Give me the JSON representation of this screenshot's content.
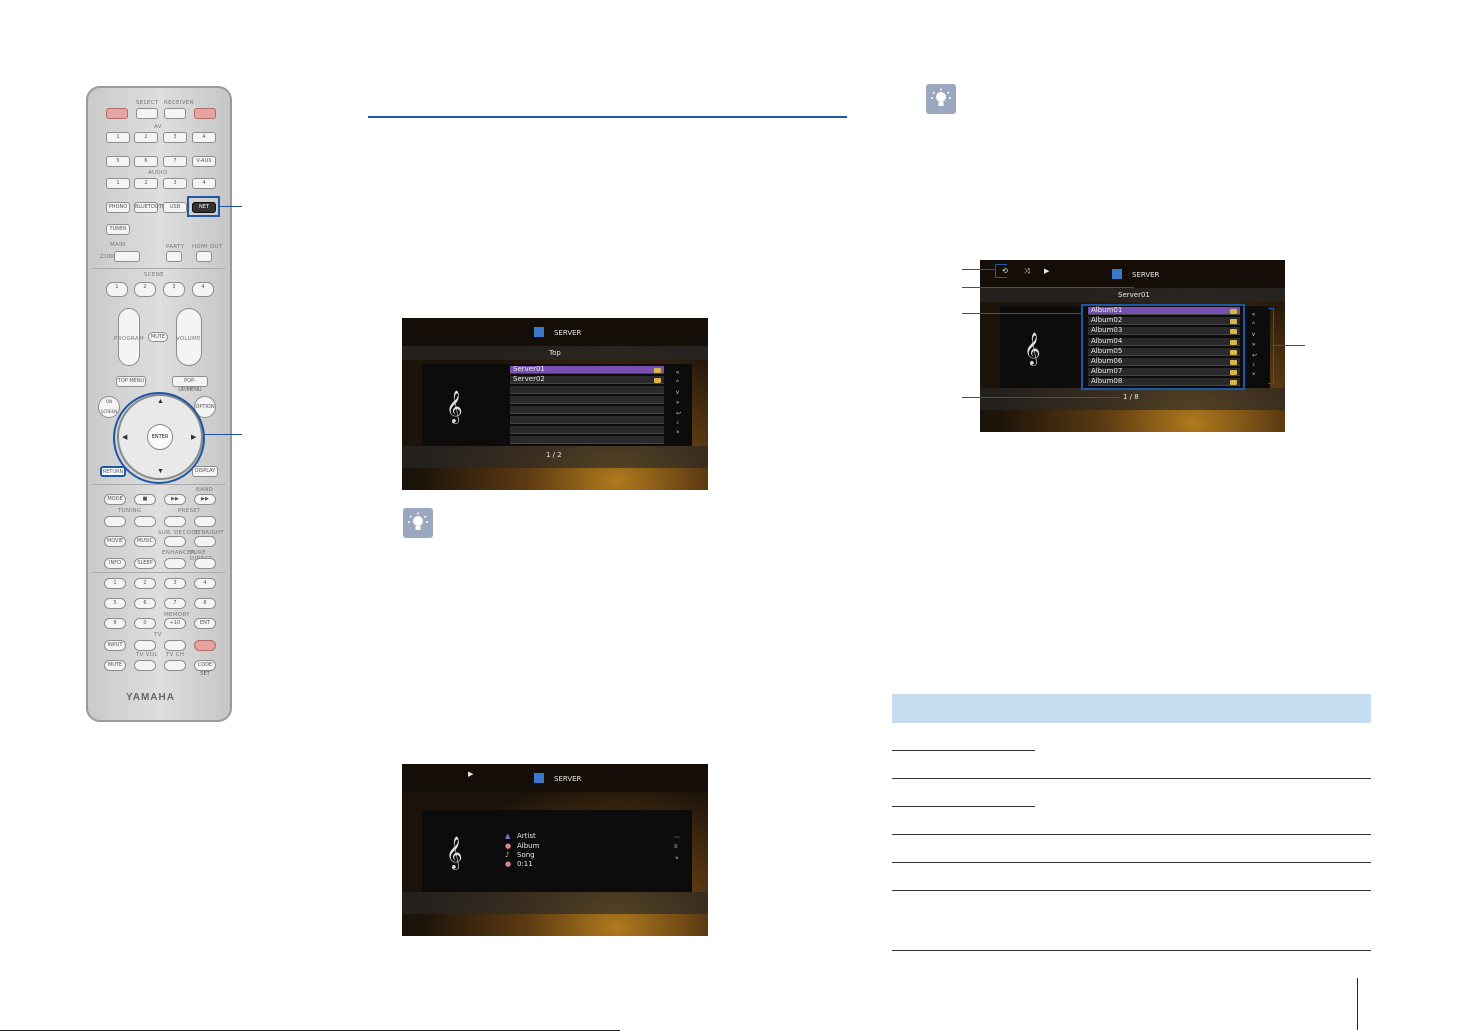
{
  "remote": {
    "select_label": "SELECT",
    "receiver_label": "RECEIVER",
    "av_label": "AV",
    "av_buttons": [
      "1",
      "2",
      "3",
      "4",
      "5",
      "6",
      "7",
      "V-AUX"
    ],
    "audio_label": "AUDIO",
    "audio_buttons": [
      "1",
      "2",
      "3",
      "4"
    ],
    "row_buttons": [
      "PHONO",
      "BLUETOOTH",
      "USB",
      "NET"
    ],
    "tuner": "TUNER",
    "main_zone": "MAIN",
    "zone": "ZONE",
    "party": "PARTY",
    "hdmi_out": "HDMI OUT",
    "scene_label": "SCENE",
    "scene_buttons": [
      "1",
      "2",
      "3",
      "4"
    ],
    "program": "PROGRAM",
    "mute": "MUTE",
    "volume": "VOLUME",
    "top_menu": "TOP MENU",
    "popup_menu": "POP-UP/MENU",
    "on_screen": "ON SCREEN",
    "option": "OPTION",
    "enter": "ENTER",
    "return": "RETURN",
    "display": "DISPLAY",
    "band": "BAND",
    "band_buttons": [
      "MODE",
      "■",
      "▶▶",
      "▶▶"
    ],
    "tuning": "TUNING",
    "preset": "PRESET",
    "movie": "MOVIE",
    "music": "MUSIC",
    "sur_decode": "SUR. DECODE",
    "straight": "STRAIGHT",
    "enhancer": "ENHANCER",
    "pure_direct": "PURE DIRECT",
    "info": "INFO",
    "sleep": "SLEEP",
    "numbers_row1": [
      "1",
      "2",
      "3",
      "4"
    ],
    "numbers_row2": [
      "5",
      "6",
      "7",
      "8"
    ],
    "numbers_row3": [
      "9",
      "0",
      "+10",
      "ENT"
    ],
    "memory": "MEMORY",
    "tv": "TV",
    "input": "INPUT",
    "tv_vol": "TV VOL",
    "tv_ch": "TV CH",
    "mute2": "MUTE",
    "code_set": "CODE SET",
    "brand": "YAMAHA"
  },
  "screen_top": {
    "title": "SERVER",
    "folder": "Top",
    "items": [
      "Server01",
      "Server02"
    ],
    "page": "1 / 2"
  },
  "screen_playback": {
    "title": "SERVER",
    "info": [
      "Artist",
      "Album",
      "Song",
      "0:11"
    ]
  },
  "screen_browse": {
    "title": "SERVER",
    "folder": "Server01",
    "items": [
      "Album01",
      "Album02",
      "Album03",
      "Album04",
      "Album05",
      "Album06",
      "Album07",
      "Album08"
    ],
    "page": "1 / 8"
  },
  "colors": {
    "accent": "#1e57a6",
    "table_header": "#c6dcf0",
    "selection": "#7a4fb4"
  }
}
